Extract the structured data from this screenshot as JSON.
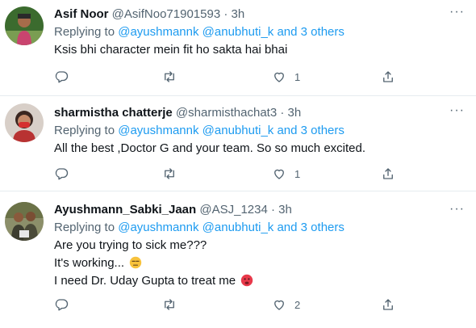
{
  "tweets": [
    {
      "name": "Asif Noor",
      "handle": "@AsifNoo71901593",
      "time": "3h",
      "replying_prefix": "Replying to",
      "mention1": "@ayushmannk",
      "mention2": "@anubhuti_k",
      "and_text": "and",
      "others": "3 others",
      "lines": [
        "Ksis bhi character mein fit ho sakta hai bhai"
      ],
      "likes": "1"
    },
    {
      "name": "sharmistha chatterje",
      "handle": "@sharmisthachat3",
      "time": "3h",
      "replying_prefix": "Replying to",
      "mention1": "@ayushmannk",
      "mention2": "@anubhuti_k",
      "and_text": "and",
      "others": "3 others",
      "lines": [
        "All the best ,Doctor G and your team. So so much excited."
      ],
      "likes": "1"
    },
    {
      "name": "Ayushmann_Sabki_Jaan",
      "handle": "@ASJ_1234",
      "time": "3h",
      "replying_prefix": "Replying to",
      "mention1": "@ayushmannk",
      "mention2": "@anubhuti_k",
      "and_text": "and",
      "others": "3 others",
      "lines": [
        "Are you trying to sick me???",
        "It's working...",
        "I need Dr. Uday Gupta to treat me"
      ],
      "likes": "2"
    }
  ],
  "icons": {
    "reply": "reply-icon",
    "retweet": "retweet-icon",
    "like": "heart-icon",
    "share": "share-icon",
    "more": "more-options-icon"
  },
  "colors": {
    "link": "#1d9bf0",
    "secondary_text": "#536471",
    "primary_text": "#0f1419",
    "divider": "#e6ecf0"
  }
}
